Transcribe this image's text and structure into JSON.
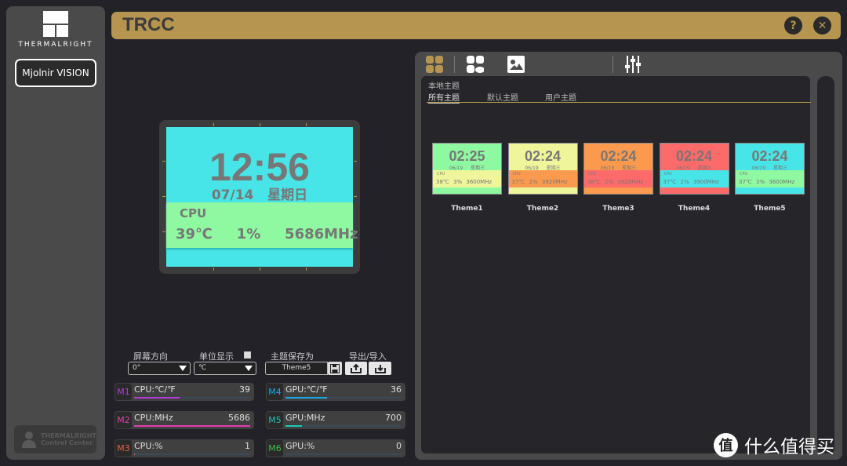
{
  "sidebar": {
    "brand": "THERMALRIGHT",
    "device_button": "Mjolnir VISION",
    "footer_line1": "THERMALRIGHT",
    "footer_line2": "Control Center"
  },
  "titlebar": {
    "title": "TRCC",
    "help_icon": "?",
    "close_icon": "✕"
  },
  "preview": {
    "time": "12:56",
    "date": "07/14",
    "weekday": "星期日",
    "cpu_label": "CPU",
    "temp": "39℃",
    "usage": "1%",
    "freq": "5686MHz"
  },
  "controls": {
    "orientation_label": "屏幕方向",
    "orientation_value": "0°",
    "unit_label": "单位显示",
    "unit_value": "℃",
    "unit_checked": false,
    "save_as_label": "主题保存为",
    "save_as_value": "Theme5",
    "export_import_label": "导出/导入"
  },
  "monitors": [
    {
      "tag": "M1",
      "name": "CPU:℃/℉",
      "value": "39",
      "fraction": 0.39,
      "color": "#b53bd6"
    },
    {
      "tag": "M2",
      "name": "CPU:MHz",
      "value": "5686",
      "fraction": 1.0,
      "color": "#e23fae"
    },
    {
      "tag": "M3",
      "name": "CPU:%",
      "value": "1",
      "fraction": 0.01,
      "color": "#e0623a"
    },
    {
      "tag": "M4",
      "name": "GPU:℃/℉",
      "value": "36",
      "fraction": 0.36,
      "color": "#1ba9e6"
    },
    {
      "tag": "M5",
      "name": "GPU:MHz",
      "value": "700",
      "fraction": 0.14,
      "color": "#19c9b5"
    },
    {
      "tag": "M6",
      "name": "GPU:%",
      "value": "0",
      "fraction": 0.0,
      "color": "#3fbf4a"
    }
  ],
  "themes_panel": {
    "section_title": "本地主题",
    "tabs": [
      "所有主题",
      "默认主题",
      "用户主题"
    ],
    "active_tab": 0,
    "themes": [
      {
        "name": "Theme1",
        "time": "02:25",
        "date": "06/19",
        "weekday": "星期三",
        "temp": "38℃",
        "usage": "3%",
        "freq": "3600MHz",
        "bg": "#8ef9a1",
        "band": "#eef59b"
      },
      {
        "name": "Theme2",
        "time": "02:24",
        "date": "06/19",
        "weekday": "星期三",
        "temp": "37℃",
        "usage": "2%",
        "freq": "3920MHz",
        "bg": "#eef59b",
        "band": "#fb9a4e"
      },
      {
        "name": "Theme3",
        "time": "02:24",
        "date": "06/19",
        "weekday": "星期三",
        "temp": "38℃",
        "usage": "2%",
        "freq": "3920MHz",
        "bg": "#fb9a4e",
        "band": "#fc6a6a"
      },
      {
        "name": "Theme4",
        "time": "02:24",
        "date": "06/19",
        "weekday": "星期三",
        "temp": "37℃",
        "usage": "2%",
        "freq": "3900MHz",
        "bg": "#fc6a6a",
        "band": "#48e5e8"
      },
      {
        "name": "Theme5",
        "time": "02:24",
        "date": "06/19",
        "weekday": "星期三",
        "temp": "37℃",
        "usage": "3%",
        "freq": "3600MHz",
        "bg": "#48e5e8",
        "band": "#8ef9a1"
      }
    ],
    "cpu_label": "CPU"
  },
  "watermark": {
    "badge": "值",
    "text": "什么值得买"
  },
  "colors": {
    "accent": "#b5954f",
    "preview_bg": "#48e5e8",
    "preview_band": "#8ef9a1"
  }
}
